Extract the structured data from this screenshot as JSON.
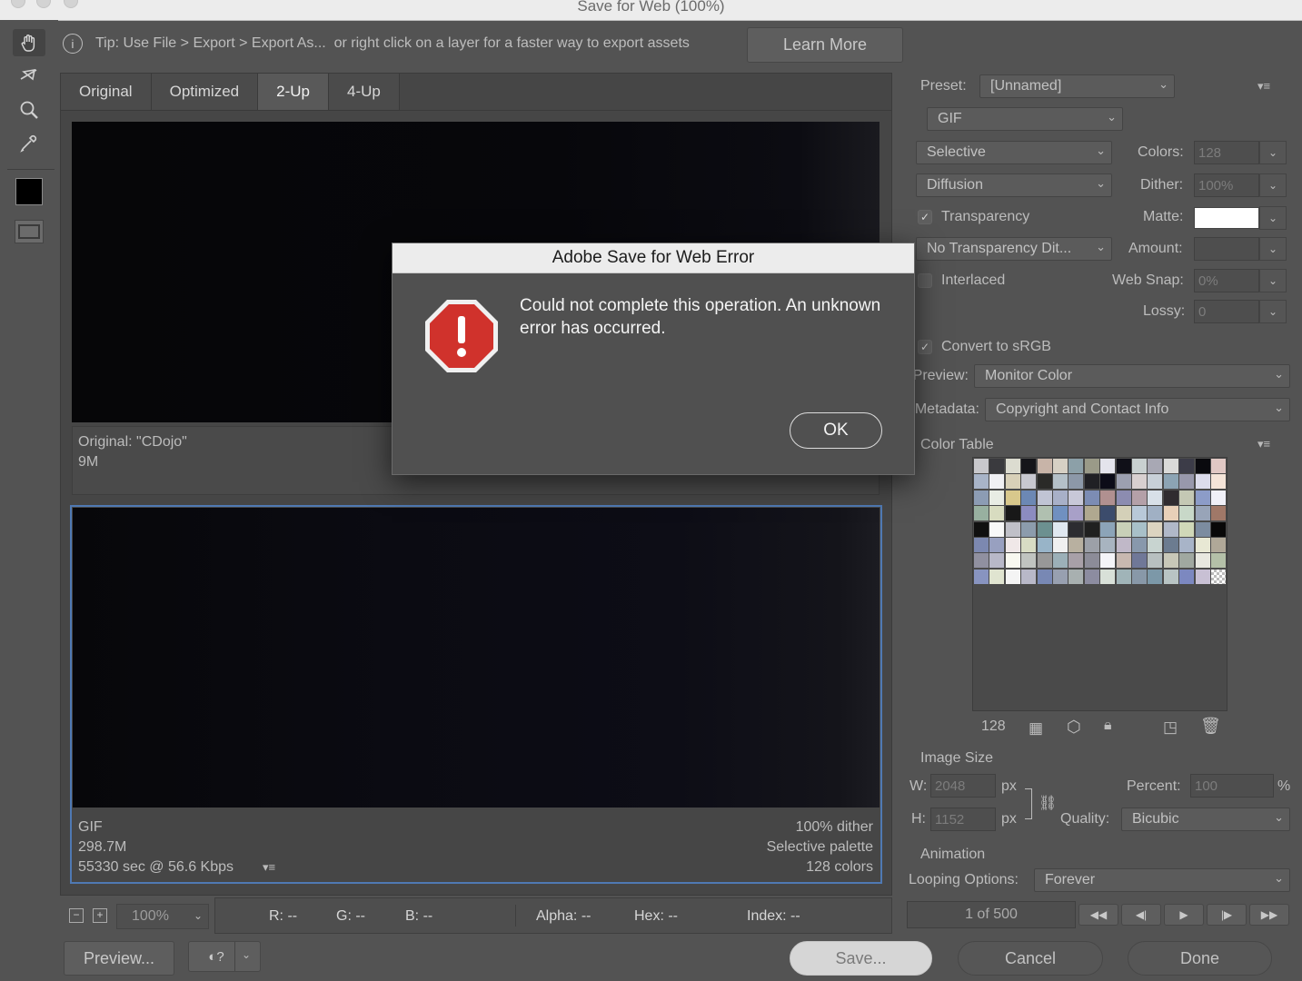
{
  "window": {
    "title": "Save for Web (100%)"
  },
  "tipbar": {
    "tip": "Tip: Use File > Export > Export As...  or right click on a layer for a faster way to export assets",
    "learn_more": "Learn More"
  },
  "tools": [
    "hand-tool-icon",
    "slice-select-tool-icon",
    "zoom-tool-icon",
    "eyedropper-tool-icon",
    "eyedropper-color-swatch",
    "toggle-slices-icon"
  ],
  "tabs": [
    {
      "label": "Original",
      "active": false
    },
    {
      "label": "Optimized",
      "active": false
    },
    {
      "label": "2-Up",
      "active": true
    },
    {
      "label": "4-Up",
      "active": false
    }
  ],
  "top_panel": {
    "line1": "Original: \"CDojo\"",
    "line2": "9M"
  },
  "bottom_panel": {
    "format": "GIF",
    "size": "298.7M",
    "time": "55330 sec @ 56.6 Kbps",
    "dither": "100% dither",
    "palette": "Selective palette",
    "colors": "128 colors"
  },
  "statusbar": {
    "zoom": "100%",
    "r": "R: --",
    "g": "G: --",
    "b": "B: --",
    "alpha": "Alpha: --",
    "hex": "Hex: --",
    "index": "Index: --"
  },
  "bottom_buttons": {
    "preview": "Preview...",
    "save": "Save...",
    "cancel": "Cancel",
    "done": "Done"
  },
  "settings": {
    "preset_label": "Preset:",
    "preset_value": "[Unnamed]",
    "format": "GIF",
    "reduction": "Selective",
    "colors_label": "Colors:",
    "colors_value": "128",
    "dither_algo": "Diffusion",
    "dither_label": "Dither:",
    "dither_value": "100%",
    "transparency_label": "Transparency",
    "transparency_checked": true,
    "matte_label": "Matte:",
    "matte_color": "#ffffff",
    "trans_dither": "No Transparency Dit...",
    "amount_label": "Amount:",
    "amount_value": "",
    "interlaced_label": "Interlaced",
    "interlaced_checked": false,
    "websnap_label": "Web Snap:",
    "websnap_value": "0%",
    "lossy_label": "Lossy:",
    "lossy_value": "0",
    "srgb_label": "Convert to sRGB",
    "srgb_checked": true,
    "preview_label": "Preview:",
    "preview_value": "Monitor Color",
    "metadata_label": "Metadata:",
    "metadata_value": "Copyright and Contact Info"
  },
  "color_table": {
    "label": "Color Table",
    "count": "128",
    "swatches": [
      "#c8c8cc",
      "#3a3a3e",
      "#dcdcd0",
      "#15151a",
      "#c8b4a8",
      "#d6d0c4",
      "#8ca0a8",
      "#9a9a88",
      "#e4e4ec",
      "#101018",
      "#c8d0d0",
      "#a8a8b4",
      "#dadad8",
      "#3c3c48",
      "#0a0a0e",
      "#e0c8c4",
      "#a8b4c8",
      "#f0f0f4",
      "#d8d0b8",
      "#c8c8d0",
      "#2a2a28",
      "#b4c0c8",
      "#8c98a8",
      "#202024",
      "#0c0c18",
      "#9ca0b0",
      "#d8d0d0",
      "#c8d0d8",
      "#8ca4b4",
      "#9898ac",
      "#dcdcec",
      "#f4e4d8",
      "#8c9cb4",
      "#e8ece4",
      "#d8c88c",
      "#6c88b4",
      "#c0c4d4",
      "#a8b0c8",
      "#c8c8d8",
      "#7c8cb4",
      "#b09090",
      "#8c8cb0",
      "#b4a0a8",
      "#d8e0e8",
      "#302c30",
      "#c4c8b4",
      "#8c9cc8",
      "#f0f0f8",
      "#98b0a0",
      "#d8dcc0",
      "#181818",
      "#8c8cc0",
      "#b0c0b0",
      "#7090c0",
      "#a8a0c8",
      "#b0a890",
      "#3c4c6c",
      "#d4d0b8",
      "#b8c8d8",
      "#a0b0c4",
      "#e8d0b8",
      "#c8d8c8",
      "#98a4b8",
      "#a07868",
      "#101010",
      "#f8f8f8",
      "#c0c0c8",
      "#8c9cac",
      "#6c9090",
      "#e0e8f0",
      "#2c2c30",
      "#202020",
      "#8ca4b8",
      "#c8d0b8",
      "#a8c0c8",
      "#dcd4c0",
      "#b0b8c8",
      "#d0d8b8",
      "#7c8ca0",
      "#080808",
      "#7c88b0",
      "#98a0c0",
      "#f0e8e8",
      "#d8dcc4",
      "#98b4c8",
      "#f0f0f0",
      "#b8b0a0",
      "#9ca0a8",
      "#a8b4c0",
      "#c0b8c8",
      "#8898ac",
      "#c8d4d0",
      "#6c7c90",
      "#a8b4c8",
      "#e8e8d4",
      "#b0a898",
      "#9090a0",
      "#b8b8c8",
      "#f8f8f0",
      "#c0c4c0",
      "#989898",
      "#9cb0b8",
      "#a8a0a8",
      "#8c8c98",
      "#f4f4f8",
      "#c8b8b0",
      "#707898",
      "#b8c0c0",
      "#c8c8b8",
      "#a0a8a0",
      "#e8e8e0",
      "#b4c0a8",
      "#8894c0",
      "#e0e4d0",
      "#f4f4f4",
      "#b8b8c8",
      "#7888b4",
      "#98a0b0",
      "#a8b0b0",
      "#8c8ca0",
      "#d8e0d8",
      "#a0b4b8",
      "#8898a8",
      "#7c98a8",
      "#b8c4c4",
      "#7c88c0",
      "#c8c0d4",
      "checker"
    ]
  },
  "image_size": {
    "label": "Image Size",
    "w_label": "W:",
    "w_value": "2048",
    "h_label": "H:",
    "h_value": "1152",
    "unit": "px",
    "percent_label": "Percent:",
    "percent_value": "100",
    "percent_unit": "%",
    "quality_label": "Quality:",
    "quality_value": "Bicubic"
  },
  "animation": {
    "label": "Animation",
    "looping_label": "Looping Options:",
    "looping_value": "Forever",
    "frame": "1 of 500"
  },
  "dialog": {
    "title": "Adobe Save for Web Error",
    "message": "Could not complete this operation. An unknown error has occurred.",
    "ok": "OK",
    "alert_color": "#d0322c"
  }
}
